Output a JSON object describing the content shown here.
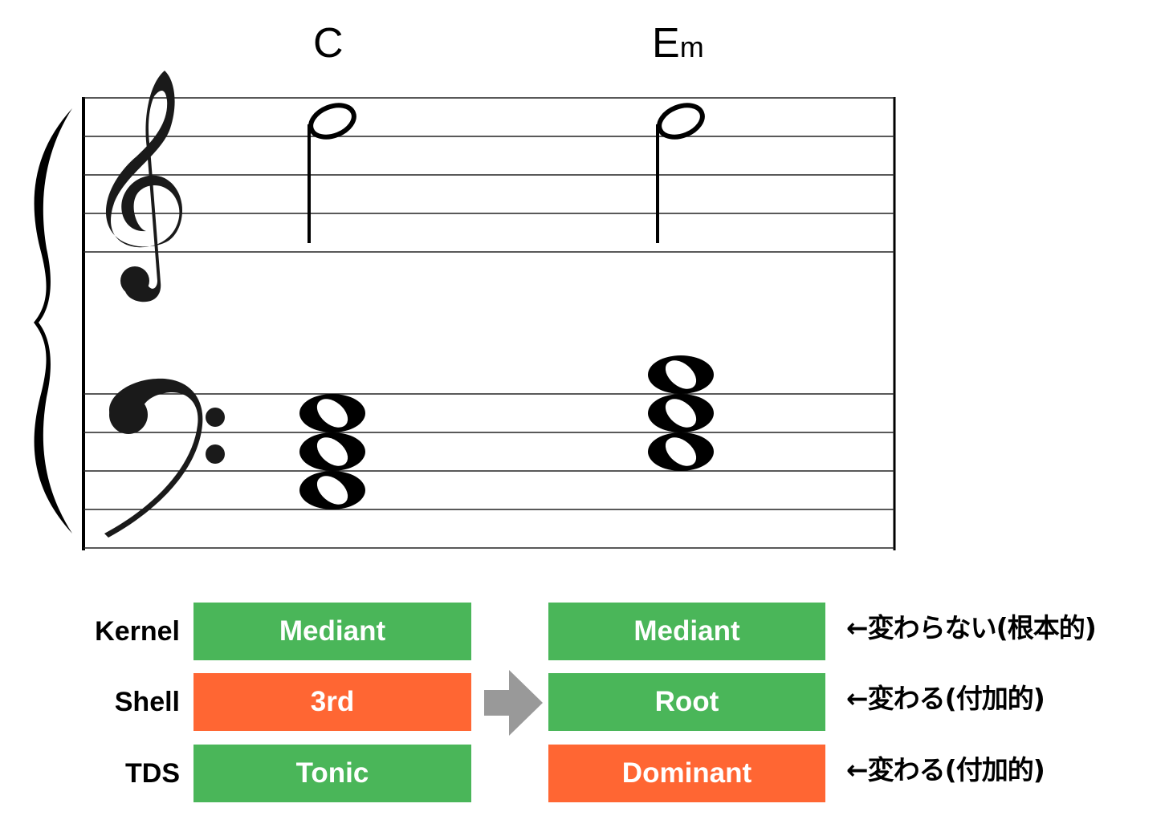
{
  "colors": {
    "unchanged": "#4ab659",
    "changed": "#ff6633",
    "arrow": "#999999",
    "ink": "#000000"
  },
  "score": {
    "staves": [
      "treble",
      "bass"
    ],
    "clef_icons": [
      "treble-clef-icon",
      "bass-clef-icon"
    ],
    "chords": [
      {
        "root": "C",
        "quality": "",
        "treble": [
          "E5 (half note)"
        ],
        "bass": [
          "C3",
          "E3",
          "G3"
        ]
      },
      {
        "root": "E",
        "quality": "m",
        "treble": [
          "E5 (half note)"
        ],
        "bass": [
          "E3",
          "G3",
          "B3"
        ]
      }
    ]
  },
  "table": {
    "rows": [
      {
        "label": "Kernel",
        "before": "Mediant",
        "after": "Mediant",
        "note": "←変わらない(根本的)",
        "before_changed": false,
        "after_changed": false
      },
      {
        "label": "Shell",
        "before": "3rd",
        "after": "Root",
        "note": "←変わる(付加的)",
        "before_changed": true,
        "after_changed": false
      },
      {
        "label": "TDS",
        "before": "Tonic",
        "after": "Dominant",
        "note": "←変わる(付加的)",
        "before_changed": false,
        "after_changed": true
      }
    ],
    "arrow_icon": "right-arrow-icon"
  }
}
